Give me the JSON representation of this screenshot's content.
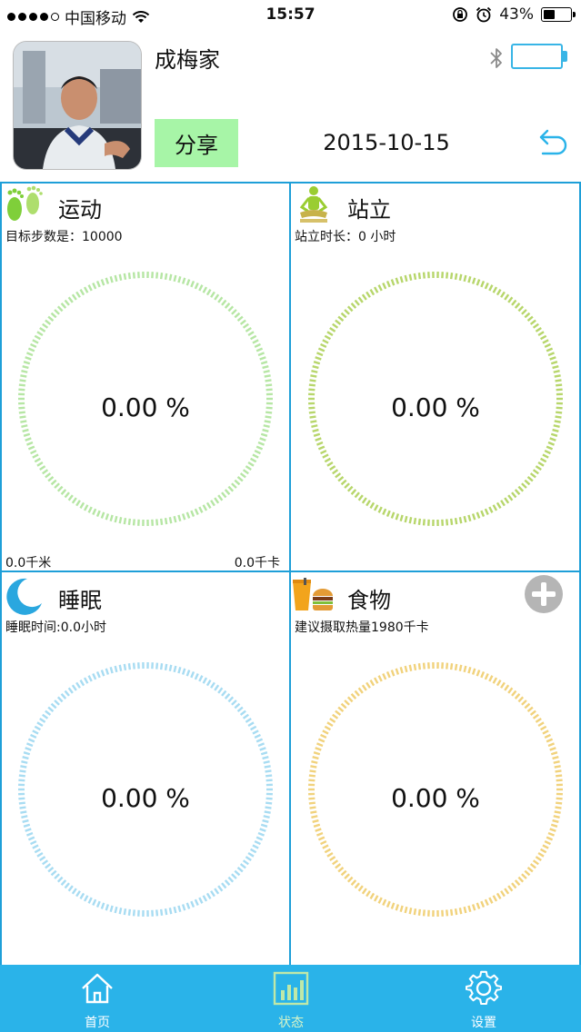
{
  "status_bar": {
    "carrier": "中国移动",
    "time": "15:57",
    "battery_percent": "43%",
    "battery_level": 0.43
  },
  "header": {
    "user_name": "成梅家",
    "share_label": "分享",
    "date": "2015-10-15",
    "device_battery_level": 0.0,
    "accent_color": "#38b5e6"
  },
  "panels": {
    "exercise": {
      "title": "运动",
      "subtitle": "目标步数是：10000",
      "percent": "0.00 %",
      "progress": 0,
      "distance": "0.0千米",
      "calories": "0.0千卡",
      "ring_color": "#b6e6a4",
      "icon": "footprints-icon"
    },
    "standing": {
      "title": "站立",
      "subtitle": "站立时长：0 小时",
      "percent": "0.00 %",
      "progress": 0,
      "ring_color": "#b7d66b",
      "icon": "meditation-person-icon"
    },
    "sleep": {
      "title": "睡眠",
      "subtitle": "睡眠时间:0.0小时",
      "percent": "0.00 %",
      "progress": 0,
      "ring_color": "#a8dcf2",
      "icon": "moon-icon"
    },
    "food": {
      "title": "食物",
      "subtitle": "建议摄取热量1980千卡",
      "percent": "0.00 %",
      "progress": 0,
      "ring_color": "#f1d27c",
      "icon": "food-drink-icon"
    }
  },
  "tabbar": {
    "tabs": [
      {
        "label": "首页",
        "icon": "home-icon"
      },
      {
        "label": "状态",
        "icon": "chart-icon"
      },
      {
        "label": "设置",
        "icon": "gear-icon"
      }
    ],
    "active_index": 1,
    "background": "#2ab3e9"
  }
}
